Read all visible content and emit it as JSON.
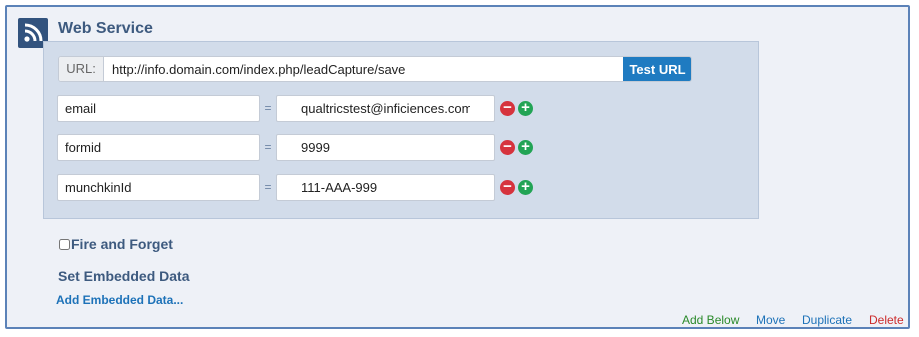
{
  "header": {
    "icon": "rss-feed-icon",
    "title": "Web Service"
  },
  "url_bar": {
    "label": "URL:",
    "value": "http://info.domain.com/index.php/leadCapture/save",
    "test_button": "Test URL"
  },
  "params": [
    {
      "key": "email",
      "equals": "=",
      "value": "qualtricstest@inficiences.com",
      "remove_icon": "minus-circle-icon",
      "add_icon": "plus-circle-icon"
    },
    {
      "key": "formid",
      "equals": "=",
      "value": "9999",
      "remove_icon": "minus-circle-icon",
      "add_icon": "plus-circle-icon"
    },
    {
      "key": "munchkinId",
      "equals": "=",
      "value": "111-AAA-999",
      "remove_icon": "minus-circle-icon",
      "add_icon": "plus-circle-icon"
    }
  ],
  "fire_and_forget": {
    "label": "Fire and Forget",
    "checked": false
  },
  "embedded": {
    "title": "Set Embedded Data",
    "add_link": "Add Embedded Data..."
  },
  "footer": {
    "add_below": "Add Below",
    "move": "Move",
    "duplicate": "Duplicate",
    "delete": "Delete"
  },
  "colors": {
    "accent": "#1f7bc1",
    "header_text": "#3d5a7f",
    "remove": "#d6333d",
    "add": "#22a455",
    "delete": "#cc2b2b"
  }
}
